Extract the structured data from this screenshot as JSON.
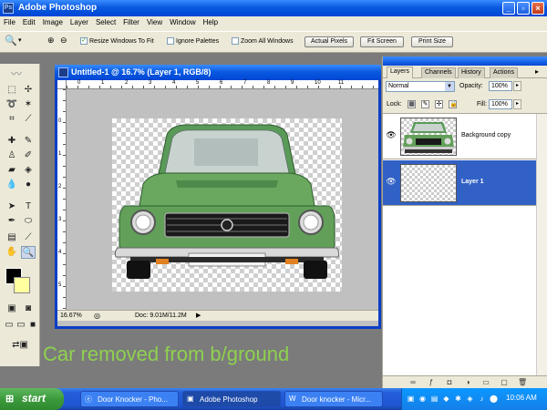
{
  "app": {
    "title": "Adobe Photoshop",
    "menu": [
      "File",
      "Edit",
      "Image",
      "Layer",
      "Select",
      "Filter",
      "View",
      "Window",
      "Help"
    ]
  },
  "options": {
    "resize_windows": "Resize Windows To Fit",
    "resize_checked": true,
    "ignore_palettes": "Ignore Palettes",
    "zoom_all": "Zoom All Windows",
    "actual_pixels": "Actual Pixels",
    "fit_screen": "Fit Screen",
    "print_size": "Print Size"
  },
  "document": {
    "title": "Untitled-1 @ 16.7% (Layer 1, RGB/8)",
    "zoom": "16.67%",
    "doc_size": "Doc: 9.01M/11.2M",
    "ruler_top": [
      "0",
      "1",
      "2",
      "3",
      "4",
      "5",
      "6",
      "7",
      "8",
      "9",
      "10",
      "11"
    ],
    "ruler_left": [
      "0",
      "1",
      "2",
      "3",
      "4",
      "5"
    ]
  },
  "layers_palette": {
    "tabs": [
      "Layers",
      "Channels",
      "History",
      "Actions"
    ],
    "blend_mode": "Normal",
    "opacity_label": "Opacity:",
    "opacity": "100%",
    "lock_label": "Lock:",
    "fill_label": "Fill:",
    "fill": "100%",
    "layers": [
      {
        "name": "Background copy",
        "selected": false
      },
      {
        "name": "Layer 1",
        "selected": true
      }
    ]
  },
  "caption": "Car removed from b/ground",
  "taskbar": {
    "start": "start",
    "tasks": [
      "Door Knocker - Pho...",
      "Adobe Photoshop",
      "Door knocker - Micr..."
    ],
    "clock": "10:06 AM"
  },
  "colors": {
    "car_body": "#6aa860",
    "caption": "#8fd14f",
    "selection": "#3161c5"
  }
}
